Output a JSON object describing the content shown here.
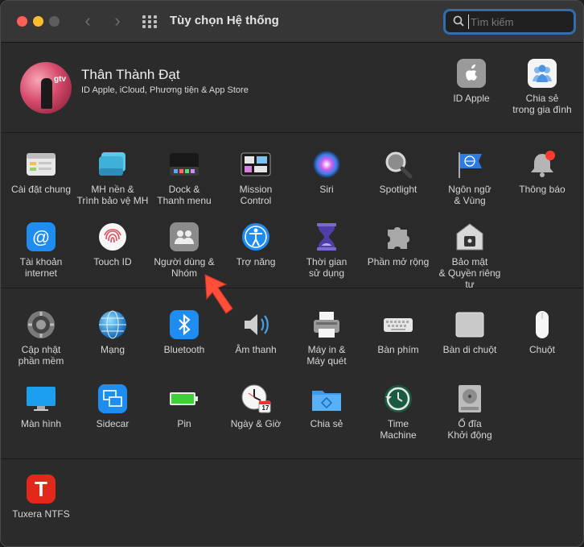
{
  "window": {
    "title": "Tùy chọn Hệ thống"
  },
  "search": {
    "placeholder": "Tìm kiếm",
    "value": ""
  },
  "user": {
    "name": "Thân Thành Đạt",
    "subtitle": "ID Apple, iCloud, Phương tiện & App Store",
    "avatar_text": "gtv"
  },
  "account_items": [
    {
      "label": "ID Apple",
      "icon": "apple-id-icon"
    },
    {
      "label": "Chia sẻ\ntrong gia đình",
      "icon": "family-sharing-icon"
    }
  ],
  "row1": [
    {
      "label": "Cài đặt chung",
      "icon": "general-icon"
    },
    {
      "label": "MH nền &\nTrình bảo vệ MH",
      "icon": "desktop-screensaver-icon"
    },
    {
      "label": "Dock &\nThanh menu",
      "icon": "dock-icon"
    },
    {
      "label": "Mission\nControl",
      "icon": "mission-control-icon"
    },
    {
      "label": "Siri",
      "icon": "siri-icon"
    },
    {
      "label": "Spotlight",
      "icon": "spotlight-icon"
    },
    {
      "label": "Ngôn ngữ\n& Vùng",
      "icon": "language-region-icon"
    },
    {
      "label": "Thông báo",
      "icon": "notifications-icon"
    }
  ],
  "row2": [
    {
      "label": "Tài khoản\ninternet",
      "icon": "internet-accounts-icon"
    },
    {
      "label": "Touch ID",
      "icon": "touch-id-icon"
    },
    {
      "label": "Người dùng &\nNhóm",
      "icon": "users-groups-icon"
    },
    {
      "label": "Trợ năng",
      "icon": "accessibility-icon"
    },
    {
      "label": "Thời gian\nsử dụng",
      "icon": "screen-time-icon"
    },
    {
      "label": "Phần mở rộng",
      "icon": "extensions-icon"
    },
    {
      "label": "Bảo mật\n& Quyền riêng tư",
      "icon": "security-privacy-icon"
    }
  ],
  "row3": [
    {
      "label": "Cập nhật\nphần mềm",
      "icon": "software-update-icon"
    },
    {
      "label": "Mạng",
      "icon": "network-icon"
    },
    {
      "label": "Bluetooth",
      "icon": "bluetooth-icon"
    },
    {
      "label": "Âm thanh",
      "icon": "sound-icon"
    },
    {
      "label": "Máy in &\nMáy quét",
      "icon": "printers-scanners-icon"
    },
    {
      "label": "Bàn phím",
      "icon": "keyboard-icon"
    },
    {
      "label": "Bàn di chuột",
      "icon": "trackpad-icon"
    },
    {
      "label": "Chuột",
      "icon": "mouse-icon"
    }
  ],
  "row4": [
    {
      "label": "Màn hình",
      "icon": "displays-icon"
    },
    {
      "label": "Sidecar",
      "icon": "sidecar-icon"
    },
    {
      "label": "Pin",
      "icon": "battery-icon"
    },
    {
      "label": "Ngày & Giờ",
      "icon": "date-time-icon",
      "badge": "17"
    },
    {
      "label": "Chia sẻ",
      "icon": "sharing-icon"
    },
    {
      "label": "Time\nMachine",
      "icon": "time-machine-icon"
    },
    {
      "label": "Ổ đĩa\nKhởi động",
      "icon": "startup-disk-icon"
    }
  ],
  "row5": [
    {
      "label": "Tuxera NTFS",
      "icon": "tuxera-ntfs-icon",
      "glyph": "T"
    }
  ],
  "colors": {
    "accent": "#2f6fb0",
    "arrow": "#ff4f3a"
  }
}
